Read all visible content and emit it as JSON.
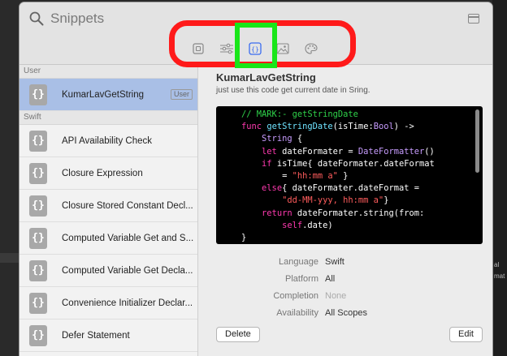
{
  "search": {
    "placeholder": "Snippets"
  },
  "tabs": [
    {
      "name": "file-template-icon"
    },
    {
      "name": "object-library-icon"
    },
    {
      "name": "code-snippet-icon",
      "selected": true
    },
    {
      "name": "media-library-icon"
    },
    {
      "name": "color-palette-icon"
    }
  ],
  "sidebar": {
    "sections": [
      {
        "title": "User",
        "items": [
          {
            "label": "KumarLavGetString",
            "badge": "User",
            "selected": true
          }
        ]
      },
      {
        "title": "Swift",
        "items": [
          {
            "label": "API Availability Check"
          },
          {
            "label": "Closure Expression"
          },
          {
            "label": "Closure Stored Constant Decl..."
          },
          {
            "label": "Computed Variable Get and S..."
          },
          {
            "label": "Computed Variable Get Decla..."
          },
          {
            "label": "Convenience Initializer Declar..."
          },
          {
            "label": "Defer Statement"
          }
        ]
      }
    ],
    "icon_glyph": "{}"
  },
  "detail": {
    "title": "KumarLavGetString",
    "description": "just use this code get current date in Sring.",
    "code_lines": [
      "    // MARK:- getStringDate",
      "    func getStringDate(isTime:Bool) ->",
      "        String {",
      "        let dateFormater = DateFormatter()",
      "        if isTime{ dateFormater.dateFormat",
      "            = \"hh:mm a\" }",
      "        else{ dateFormater.dateFormat =",
      "            \"dd-MM-yyy, hh:mm a\"}",
      "        return dateFormater.string(from:",
      "            self.date)",
      "    }"
    ],
    "meta": [
      {
        "label": "Language",
        "value": "Swift"
      },
      {
        "label": "Platform",
        "value": "All"
      },
      {
        "label": "Completion",
        "value": "None",
        "muted": true
      },
      {
        "label": "Availability",
        "value": "All Scopes"
      }
    ],
    "delete_label": "Delete",
    "edit_label": "Edit"
  },
  "background_text": [
    "al",
    "mat"
  ],
  "colors": {
    "annotation_ring": "#ff1a1a",
    "annotation_box": "#19e619",
    "selection": "#a9bfe6",
    "selected_tab": "#3a6cf0"
  }
}
